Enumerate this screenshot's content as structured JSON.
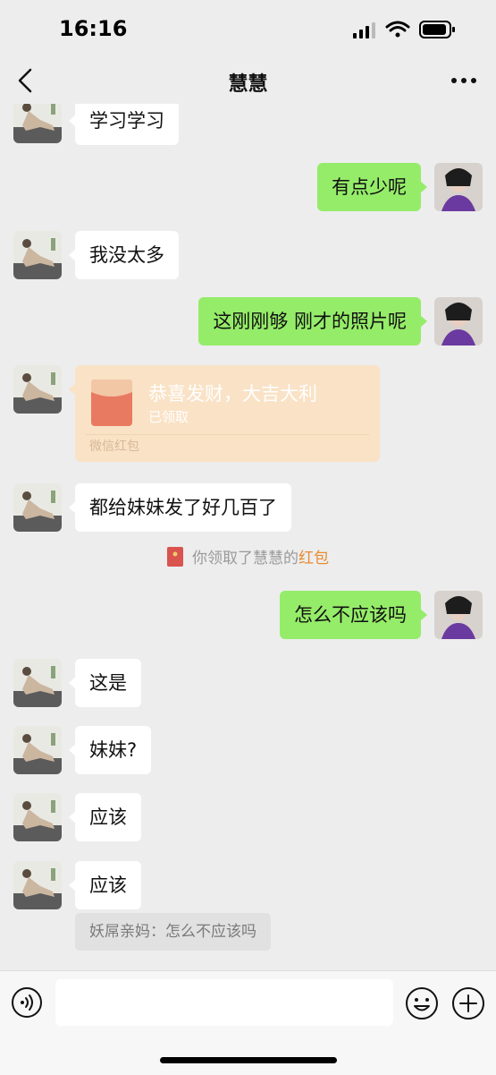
{
  "status_bar": {
    "time": "16:16"
  },
  "header": {
    "title": "慧慧"
  },
  "messages": [
    {
      "text": "学习学习"
    },
    {
      "text": "有点少呢"
    },
    {
      "text": "我没太多"
    },
    {
      "text": "这刚刚够 刚才的照片呢"
    },
    {
      "text": "都给妹妹发了好几百了"
    },
    {
      "text": "怎么不应该吗"
    },
    {
      "text": "这是"
    },
    {
      "text": "妹妹?"
    },
    {
      "text": "应该"
    },
    {
      "text": "应该"
    }
  ],
  "red_packet": {
    "title": "恭喜发财，大吉大利",
    "status": "已领取",
    "label": "微信红包"
  },
  "system_notice": {
    "prefix": "你领取了慧慧的",
    "link": "红包"
  },
  "quote": {
    "text": "妖屌亲妈：怎么不应该吗"
  },
  "colors": {
    "background": "#ededed",
    "incoming_bubble": "#ffffff",
    "outgoing_bubble": "#95ec69",
    "red_packet": "#f9e2c6",
    "red_packet_icon": "#e87a62",
    "link": "#e88b32"
  },
  "icons": [
    "back-arrow-icon",
    "more-dots-icon",
    "voice-icon",
    "emoji-icon",
    "plus-icon",
    "red-packet-icon"
  ]
}
